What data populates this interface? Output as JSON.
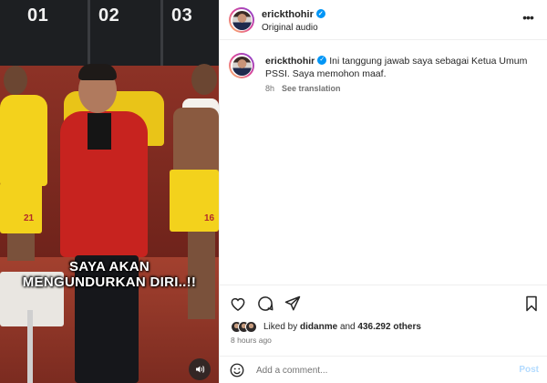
{
  "video": {
    "locker_numbers": [
      "01",
      "02",
      "03"
    ],
    "shorts_numbers": [
      "21",
      "16"
    ],
    "caption_line1": "SAYA AKAN",
    "caption_line2": "MENGUNDURKAN DIRI..!!",
    "audio_icon": "speaker-icon"
  },
  "header": {
    "username": "erickthohir",
    "verified": true,
    "subtitle": "Original audio",
    "more_icon": "more-icon"
  },
  "post_caption": {
    "username": "erickthohir",
    "text": "Ini tanggung jawab saya sebagai Ketua Umum PSSI. Saya memohon maaf.",
    "age": "8h",
    "see_translation": "See translation"
  },
  "actions": {
    "icons": [
      "heart-icon",
      "comment-icon",
      "share-icon",
      "bookmark-icon"
    ]
  },
  "likes": {
    "prefix": "Liked by",
    "user": "didanme",
    "joiner": "and",
    "count": "436.292 others"
  },
  "timestamp": "8 hours ago",
  "comment": {
    "placeholder": "Add a comment...",
    "post_label": "Post"
  },
  "colors": {
    "verified": "#0095f6",
    "post_disabled": "#b3dbff",
    "jacket": "#c7231f",
    "jersey": "#f3d21c"
  }
}
